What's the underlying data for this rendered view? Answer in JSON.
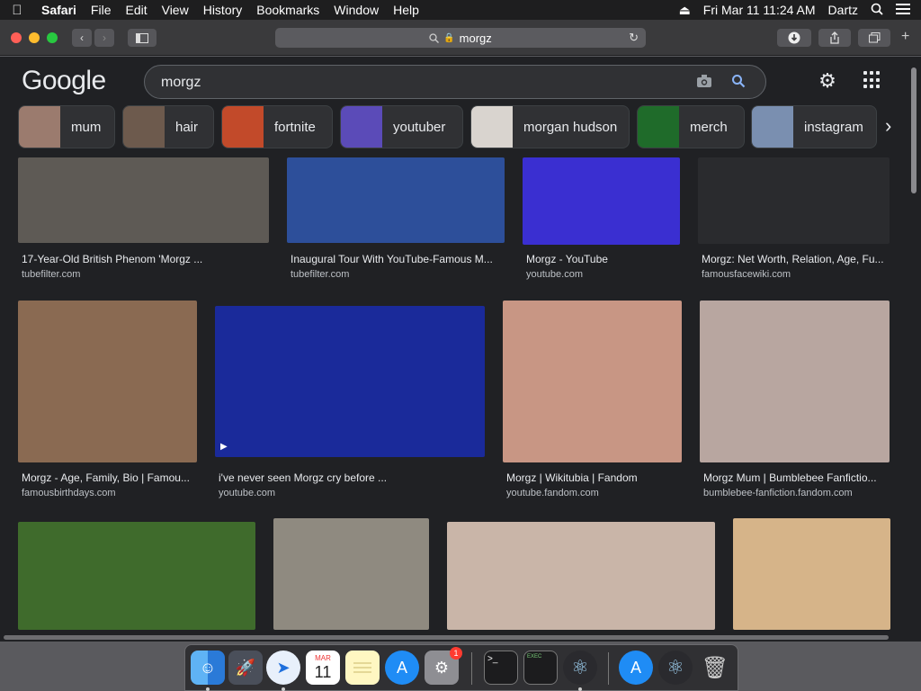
{
  "menubar": {
    "apple": "",
    "items": [
      "Safari",
      "File",
      "Edit",
      "View",
      "History",
      "Bookmarks",
      "Window",
      "Help"
    ],
    "clock": "Fri Mar 11  11:24 AM",
    "user": "Dartz"
  },
  "browser": {
    "address": "morgz",
    "lock": "🔒"
  },
  "google": {
    "logo": "Google",
    "query": "morgz"
  },
  "chips": [
    {
      "label": "mum",
      "color": "#9b7b6e"
    },
    {
      "label": "hair",
      "color": "#6d5a4d"
    },
    {
      "label": "fortnite",
      "color": "#c24a2a"
    },
    {
      "label": "youtuber",
      "color": "#5b4bb8"
    },
    {
      "label": "morgan hudson",
      "color": "#d9d4cf"
    },
    {
      "label": "merch",
      "color": "#1f6b2a"
    },
    {
      "label": "instagram",
      "color": "#7a8fb0"
    }
  ],
  "results": [
    {
      "title": "17-Year-Old British Phenom 'Morgz ...",
      "source": "tubefilter.com",
      "color": "#5e5a55"
    },
    {
      "title": "Inaugural Tour With YouTube-Famous M...",
      "source": "tubefilter.com",
      "color": "#2d4f9a"
    },
    {
      "title": "Morgz - YouTube",
      "source": "youtube.com",
      "color": "#3a2fd1"
    },
    {
      "title": "Morgz: Net Worth, Relation, Age, Fu...",
      "source": "famousfacewiki.com",
      "color": "#2a2b2e"
    },
    {
      "title": "Morgz - Age, Family, Bio | Famou...",
      "source": "famousbirthdays.com",
      "color": "#8a6a52"
    },
    {
      "title": "i've never seen Morgz cry before ...",
      "source": "youtube.com",
      "color": "#1a2a9a"
    },
    {
      "title": "Morgz | Wikitubia | Fandom",
      "source": "youtube.fandom.com",
      "color": "#c89684"
    },
    {
      "title": "Morgz Mum | Bumblebee Fanfictio...",
      "source": "bumblebee-fanfiction.fandom.com",
      "color": "#b8a6a0"
    },
    {
      "title": "",
      "source": "",
      "color": "#3f6b2c"
    },
    {
      "title": "",
      "source": "",
      "color": "#8f8a80"
    },
    {
      "title": "",
      "source": "",
      "color": "#c9b5a8"
    },
    {
      "title": "",
      "source": "",
      "color": "#d6b489"
    }
  ],
  "dock": {
    "calendar_month": "MAR",
    "calendar_day": "11",
    "badge": "1"
  }
}
